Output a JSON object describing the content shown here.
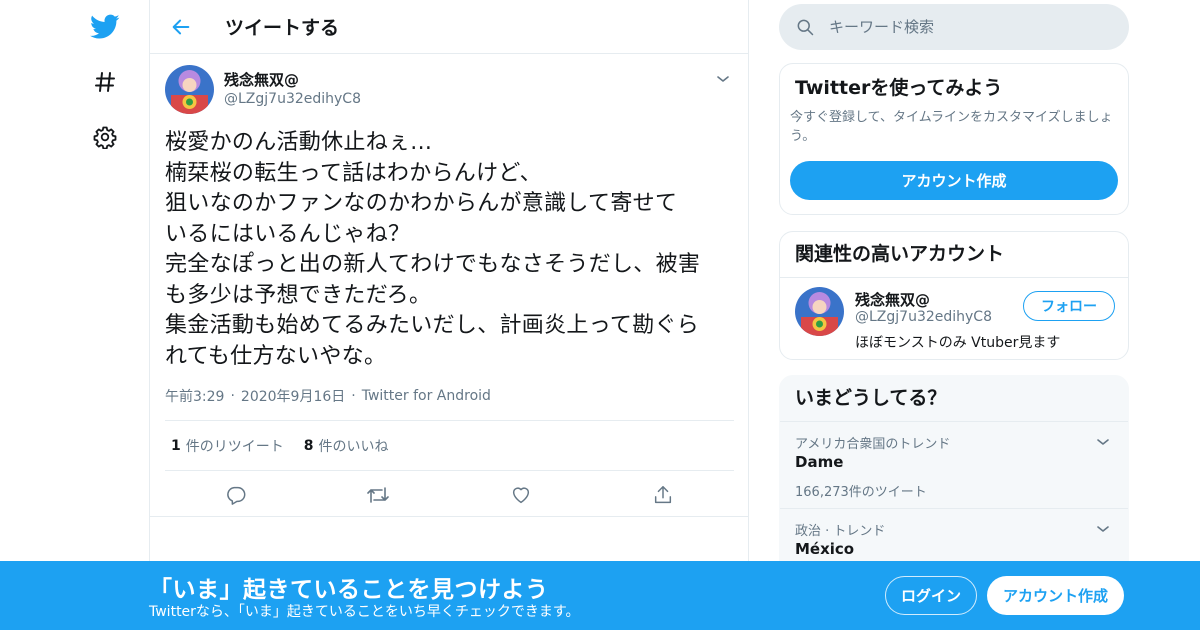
{
  "colors": {
    "accent": "#1da1f2",
    "text": "#14171a",
    "secondary": "#657786",
    "border": "#e6ecf0"
  },
  "nav": {
    "items": [
      {
        "name": "twitter-logo",
        "icon": "twitter-bird-icon"
      },
      {
        "name": "explore",
        "icon": "hashtag-icon"
      },
      {
        "name": "settings",
        "icon": "gear-icon"
      }
    ]
  },
  "header": {
    "title": "ツイートする",
    "back_icon": "arrow-left-icon"
  },
  "tweet": {
    "author_name": "残念無双@",
    "author_handle": "@LZgj7u32edihyC8",
    "lines": [
      "桜愛かのん活動休止ねぇ...",
      "楠栞桜の転生って話はわからんけど、",
      "狙いなのかファンなのかわからんが意識して寄せて",
      "いるにはいるんじゃね？",
      "完全なぽっと出の新人てわけでもなさそうだし、被害",
      "も多少は予想できただろ。",
      "集金活動も始めてるみたいだし、計画炎上って勘ぐら",
      "れても仕方ないやな。"
    ],
    "time": "午前3:29",
    "date": "2020年9月16日",
    "source": "Twitter for Android",
    "separator": "·",
    "retweet_count": "1",
    "retweet_label": "件のリツイート",
    "like_count": "8",
    "like_label": "件のいいね"
  },
  "sidebar": {
    "search_placeholder": "キーワード検索",
    "signup_card": {
      "title": "Twitterを使ってみよう",
      "description": "今すぐ登録して、タイムラインをカスタマイズしましょう。",
      "button": "アカウント作成"
    },
    "related_card": {
      "title": "関連性の高いアカウント",
      "user_name": "残念無双@",
      "user_handle": "@LZgj7u32edihyC8",
      "user_bio": "ほぼモンストのみ Vtuber見ます",
      "follow_button": "フォロー"
    },
    "trends_card": {
      "title": "いまどうしてる？",
      "trends": [
        {
          "context": "アメリカ合衆国のトレンド",
          "name": "Dame",
          "count": "166,273件のツイート"
        },
        {
          "context": "政治 · トレンド",
          "name": "México"
        }
      ]
    }
  },
  "banner": {
    "title": "「いま」起きていることを見つけよう",
    "subtitle": "Twitterなら、「いま」起きていることをいち早くチェックできます。",
    "login_button": "ログイン",
    "signup_button": "アカウント作成"
  }
}
